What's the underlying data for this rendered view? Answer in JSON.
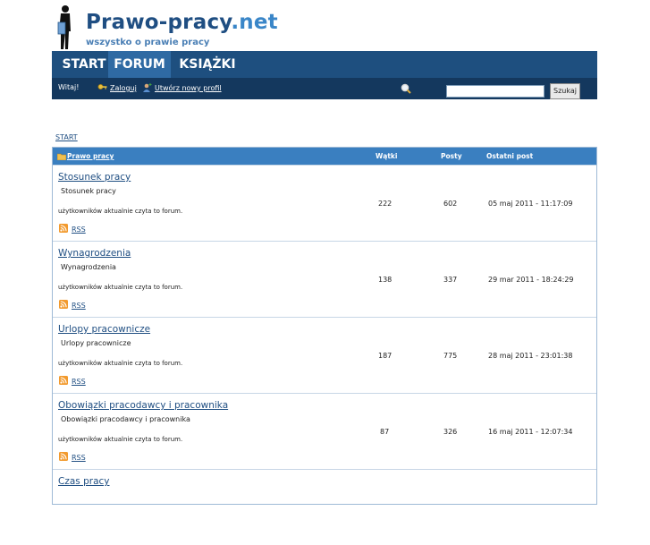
{
  "header": {
    "title_main": "Prawo-pracy",
    "title_tld": ".net",
    "tagline": "wszystko o prawie pracy"
  },
  "nav": [
    "START",
    "FORUM",
    "KSIĄŻKI"
  ],
  "userbar": {
    "welcome": "Witaj!",
    "login": "Zaloguj",
    "register": "Utwórz nowy profil",
    "search_value": "",
    "search_button": "Szukaj"
  },
  "breadcrumb": "START",
  "table": {
    "category": "Prawo pracy",
    "headers": [
      "Wątki",
      "Posty",
      "Ostatni post"
    ],
    "rows": [
      {
        "name": "Stosunek pracy",
        "desc": "Stosunek pracy",
        "users": "użytkowników aktualnie czyta to forum.",
        "rss": "RSS",
        "threads": "222",
        "posts": "602",
        "last": "05 maj 2011 - 11:17:09"
      },
      {
        "name": "Wynagrodzenia",
        "desc": "Wynagrodzenia",
        "users": "użytkowników aktualnie czyta to forum.",
        "rss": "RSS",
        "threads": "138",
        "posts": "337",
        "last": "29 mar 2011 - 18:24:29"
      },
      {
        "name": "Urlopy pracownicze",
        "desc": "Urlopy pracownicze",
        "users": "użytkowników aktualnie czyta to forum.",
        "rss": "RSS",
        "threads": "187",
        "posts": "775",
        "last": "28 maj 2011 - 23:01:38"
      },
      {
        "name": "Obowiązki pracodawcy i pracownika",
        "desc": "Obowiązki pracodawcy i pracownika",
        "users": "użytkowników aktualnie czyta to forum.",
        "rss": "RSS",
        "threads": "87",
        "posts": "326",
        "last": "16 maj 2011 - 12:07:34"
      },
      {
        "name": "Czas pracy",
        "desc": "",
        "users": "",
        "rss": "",
        "threads": "",
        "posts": "",
        "last": ""
      }
    ]
  }
}
